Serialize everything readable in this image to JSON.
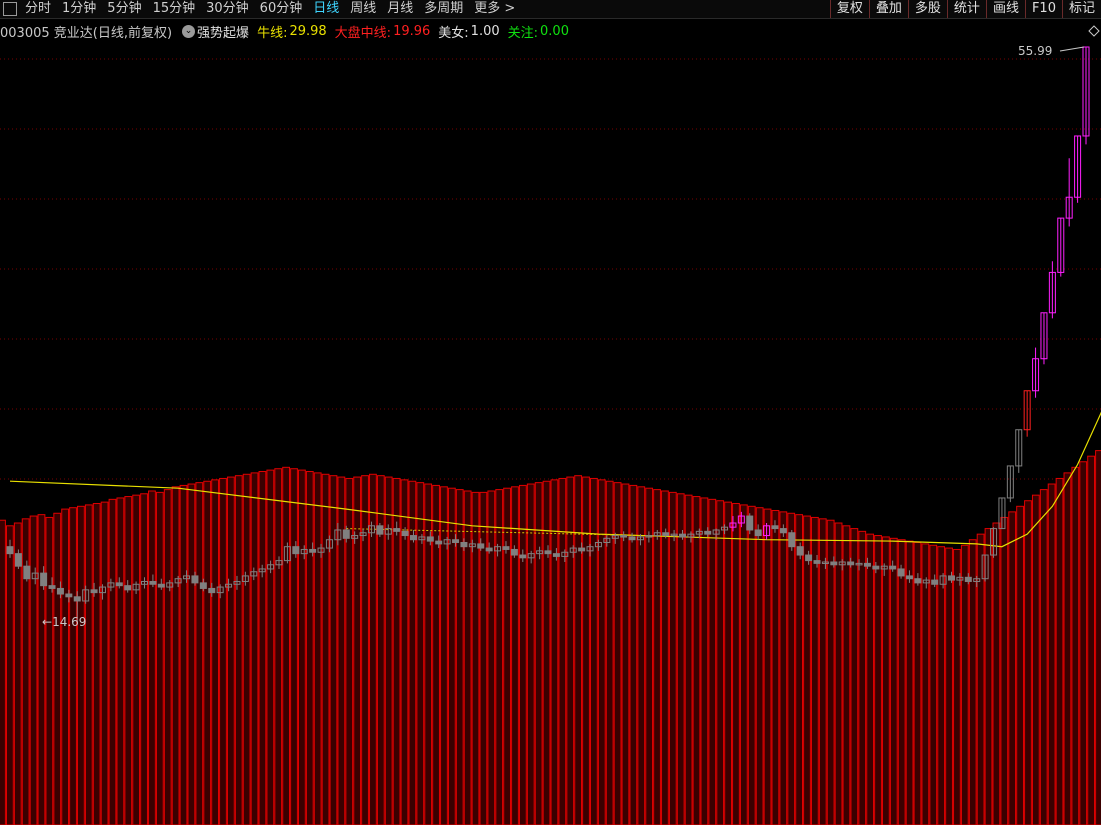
{
  "toolbar": {
    "periods": [
      "分时",
      "1分钟",
      "5分钟",
      "15分钟",
      "30分钟",
      "60分钟",
      "日线",
      "周线",
      "月线",
      "多周期",
      "更多 >"
    ],
    "active_period": "日线",
    "right_buttons": [
      "复权",
      "叠加",
      "多股",
      "统计",
      "画线",
      "F10",
      "标记"
    ]
  },
  "info": {
    "stock": "003005 竞业达(日线,前复权)",
    "indicator": "强势起爆",
    "bull_label": "牛线:",
    "bull_value": "29.98",
    "dapan_label": "大盘中线:",
    "dapan_value": "19.96",
    "meinv_label": "美女:",
    "meinv_value": "1.00",
    "guanzhu_label": "关注:",
    "guanzhu_value": "0.00"
  },
  "labels": {
    "high": "55.99",
    "low": "14.69"
  },
  "colors": {
    "bull_line": "#e8e000",
    "dapan": "#ff2020",
    "up": "#ff20ff",
    "down": "#808080",
    "bar": "#e00000",
    "grid": "#7a0000",
    "green": "#10e010"
  },
  "chart_data": {
    "type": "candlestick",
    "price_high": 55.99,
    "price_low": 14.69,
    "candles": [
      [
        20.1,
        20.6,
        19.3,
        19.6
      ],
      [
        19.6,
        19.9,
        18.5,
        18.7
      ],
      [
        18.7,
        19.1,
        17.6,
        17.8
      ],
      [
        17.8,
        18.6,
        17.4,
        18.2
      ],
      [
        18.2,
        18.7,
        17.0,
        17.3
      ],
      [
        17.3,
        17.9,
        16.8,
        17.1
      ],
      [
        17.1,
        17.6,
        16.4,
        16.7
      ],
      [
        16.7,
        17.0,
        16.1,
        16.5
      ],
      [
        16.5,
        16.9,
        14.7,
        16.2
      ],
      [
        16.2,
        17.3,
        16.0,
        17.0
      ],
      [
        17.0,
        17.5,
        16.5,
        16.8
      ],
      [
        16.8,
        17.4,
        16.3,
        17.2
      ],
      [
        17.2,
        17.8,
        16.9,
        17.5
      ],
      [
        17.5,
        17.9,
        17.1,
        17.3
      ],
      [
        17.3,
        17.7,
        16.8,
        17.0
      ],
      [
        17.0,
        17.6,
        16.7,
        17.4
      ],
      [
        17.4,
        17.9,
        17.1,
        17.6
      ],
      [
        17.6,
        18.1,
        17.2,
        17.4
      ],
      [
        17.4,
        17.8,
        17.0,
        17.2
      ],
      [
        17.2,
        17.7,
        16.9,
        17.5
      ],
      [
        17.5,
        18.0,
        17.2,
        17.8
      ],
      [
        17.8,
        18.4,
        17.5,
        18.0
      ],
      [
        18.0,
        18.3,
        17.3,
        17.5
      ],
      [
        17.5,
        17.8,
        16.9,
        17.1
      ],
      [
        17.1,
        17.5,
        16.5,
        16.8
      ],
      [
        16.8,
        17.4,
        16.4,
        17.2
      ],
      [
        17.2,
        17.8,
        16.9,
        17.4
      ],
      [
        17.4,
        18.0,
        17.0,
        17.6
      ],
      [
        17.6,
        18.3,
        17.3,
        18.0
      ],
      [
        18.0,
        18.6,
        17.7,
        18.3
      ],
      [
        18.3,
        18.8,
        17.9,
        18.5
      ],
      [
        18.5,
        19.1,
        18.2,
        18.8
      ],
      [
        18.8,
        19.4,
        18.5,
        19.1
      ],
      [
        19.1,
        20.4,
        18.9,
        20.1
      ],
      [
        20.1,
        20.5,
        19.3,
        19.6
      ],
      [
        19.6,
        20.2,
        19.2,
        19.9
      ],
      [
        19.9,
        20.4,
        19.4,
        19.7
      ],
      [
        19.7,
        20.3,
        19.3,
        20.0
      ],
      [
        20.0,
        20.9,
        19.7,
        20.6
      ],
      [
        20.6,
        21.8,
        20.2,
        21.3
      ],
      [
        21.3,
        21.6,
        20.4,
        20.7
      ],
      [
        20.7,
        21.2,
        20.3,
        20.9
      ],
      [
        20.9,
        21.4,
        20.5,
        21.1
      ],
      [
        21.1,
        21.9,
        20.8,
        21.6
      ],
      [
        21.6,
        21.8,
        20.8,
        21.0
      ],
      [
        21.0,
        21.7,
        20.6,
        21.4
      ],
      [
        21.4,
        21.9,
        20.9,
        21.2
      ],
      [
        21.2,
        21.5,
        20.6,
        20.9
      ],
      [
        20.9,
        21.3,
        20.4,
        20.6
      ],
      [
        20.6,
        21.0,
        20.3,
        20.8
      ],
      [
        20.8,
        21.2,
        20.2,
        20.5
      ],
      [
        20.5,
        20.9,
        20.0,
        20.3
      ],
      [
        20.3,
        20.8,
        19.9,
        20.6
      ],
      [
        20.6,
        21.0,
        20.1,
        20.4
      ],
      [
        20.4,
        20.7,
        19.8,
        20.1
      ],
      [
        20.1,
        20.6,
        19.7,
        20.3
      ],
      [
        20.3,
        20.7,
        19.8,
        20.0
      ],
      [
        20.0,
        20.4,
        19.6,
        19.8
      ],
      [
        19.8,
        20.3,
        19.4,
        20.1
      ],
      [
        20.1,
        20.5,
        19.6,
        19.9
      ],
      [
        19.9,
        20.2,
        19.3,
        19.5
      ],
      [
        19.5,
        19.9,
        19.0,
        19.3
      ],
      [
        19.3,
        19.8,
        18.9,
        19.6
      ],
      [
        19.6,
        20.1,
        19.2,
        19.8
      ],
      [
        19.8,
        20.2,
        19.3,
        19.6
      ],
      [
        19.6,
        20.0,
        19.1,
        19.4
      ],
      [
        19.4,
        19.9,
        19.0,
        19.7
      ],
      [
        19.7,
        20.2,
        19.3,
        20.0
      ],
      [
        20.0,
        20.4,
        19.6,
        19.8
      ],
      [
        19.8,
        20.3,
        19.4,
        20.1
      ],
      [
        20.1,
        20.6,
        19.8,
        20.4
      ],
      [
        20.4,
        20.9,
        20.1,
        20.7
      ],
      [
        20.7,
        21.1,
        20.3,
        20.9
      ],
      [
        20.9,
        21.2,
        20.5,
        20.8
      ],
      [
        20.8,
        21.1,
        20.4,
        20.6
      ],
      [
        20.6,
        21.0,
        20.2,
        20.8
      ],
      [
        20.8,
        21.2,
        20.4,
        20.9
      ],
      [
        20.9,
        21.3,
        20.6,
        21.1
      ],
      [
        21.1,
        21.4,
        20.7,
        20.9
      ],
      [
        20.9,
        21.3,
        20.5,
        21.0
      ],
      [
        21.0,
        21.3,
        20.6,
        20.8
      ],
      [
        20.8,
        21.2,
        20.4,
        21.0
      ],
      [
        21.0,
        21.4,
        20.7,
        21.2
      ],
      [
        21.2,
        21.5,
        20.8,
        21.0
      ],
      [
        21.0,
        21.4,
        20.6,
        21.3
      ],
      [
        21.3,
        21.7,
        21.0,
        21.5
      ],
      [
        21.5,
        22.3,
        21.2,
        21.8
      ],
      [
        21.8,
        22.6,
        21.5,
        22.3
      ],
      [
        22.3,
        22.5,
        21.0,
        21.3
      ],
      [
        21.3,
        21.7,
        20.6,
        20.9
      ],
      [
        20.9,
        21.8,
        20.6,
        21.6
      ],
      [
        21.6,
        22.0,
        21.1,
        21.4
      ],
      [
        21.4,
        21.7,
        20.8,
        21.1
      ],
      [
        21.1,
        21.3,
        19.8,
        20.1
      ],
      [
        20.1,
        20.4,
        19.2,
        19.5
      ],
      [
        19.5,
        19.8,
        18.8,
        19.1
      ],
      [
        19.1,
        19.5,
        18.6,
        18.9
      ],
      [
        18.9,
        19.3,
        18.5,
        19.0
      ],
      [
        19.0,
        19.4,
        18.6,
        18.8
      ],
      [
        18.8,
        19.2,
        18.4,
        19.0
      ],
      [
        19.0,
        19.3,
        18.6,
        18.8
      ],
      [
        18.8,
        19.2,
        18.4,
        18.9
      ],
      [
        18.9,
        19.3,
        18.5,
        18.7
      ],
      [
        18.7,
        19.0,
        18.2,
        18.5
      ],
      [
        18.5,
        18.9,
        18.0,
        18.7
      ],
      [
        18.7,
        19.1,
        18.3,
        18.5
      ],
      [
        18.5,
        18.8,
        17.8,
        18.0
      ],
      [
        18.0,
        18.4,
        17.5,
        17.8
      ],
      [
        17.8,
        18.2,
        17.3,
        17.5
      ],
      [
        17.5,
        17.9,
        17.1,
        17.7
      ],
      [
        17.7,
        18.1,
        17.2,
        17.4
      ],
      [
        17.4,
        18.2,
        17.1,
        18.0
      ],
      [
        18.0,
        18.3,
        17.5,
        17.7
      ],
      [
        17.7,
        18.2,
        17.3,
        17.9
      ],
      [
        17.9,
        18.2,
        17.4,
        17.6
      ],
      [
        17.6,
        18.0,
        17.2,
        17.8
      ],
      [
        17.8,
        19.5,
        17.6,
        19.5
      ],
      [
        19.5,
        21.5,
        19.3,
        21.4
      ],
      [
        21.4,
        23.6,
        21.4,
        23.6
      ],
      [
        23.6,
        25.9,
        23.3,
        25.9
      ],
      [
        25.9,
        28.5,
        25.4,
        28.5
      ],
      [
        28.5,
        31.3,
        28.0,
        31.3
      ],
      [
        31.3,
        34.4,
        30.8,
        33.6
      ],
      [
        33.6,
        36.9,
        33.2,
        36.9
      ],
      [
        36.9,
        40.6,
        36.5,
        39.8
      ],
      [
        39.8,
        43.7,
        39.5,
        43.7
      ],
      [
        43.7,
        48.0,
        43.1,
        45.2
      ],
      [
        45.2,
        49.6,
        44.8,
        49.6
      ],
      [
        49.6,
        55.99,
        49.0,
        55.99
      ]
    ],
    "bull_line": [
      {
        "bar": 0,
        "price": 24.8
      },
      {
        "bar": 20,
        "price": 24.3
      },
      {
        "bar": 40,
        "price": 22.8
      },
      {
        "bar": 55,
        "price": 21.6
      },
      {
        "bar": 70,
        "price": 21.0
      },
      {
        "bar": 90,
        "price": 20.6
      },
      {
        "bar": 105,
        "price": 20.5
      },
      {
        "bar": 115,
        "price": 20.3
      },
      {
        "bar": 118,
        "price": 20.1
      },
      {
        "bar": 121,
        "price": 21.0
      },
      {
        "bar": 124,
        "price": 23.0
      },
      {
        "bar": 127,
        "price": 26.0
      },
      {
        "bar": 130,
        "price": 29.98
      }
    ],
    "volume_top": [
      22.0,
      21.6,
      21.8,
      22.1,
      22.3,
      22.4,
      22.2,
      22.5,
      22.8,
      22.9,
      23.0,
      23.1,
      23.2,
      23.3,
      23.5,
      23.6,
      23.7,
      23.8,
      23.9,
      24.1,
      24.0,
      24.2,
      24.4,
      24.5,
      24.6,
      24.7,
      24.8,
      24.9,
      25.0,
      25.1,
      25.2,
      25.3,
      25.4,
      25.5,
      25.6,
      25.7,
      25.8,
      25.7,
      25.6,
      25.5,
      25.4,
      25.3,
      25.2,
      25.1,
      25.0,
      25.1,
      25.2,
      25.3,
      25.2,
      25.1,
      25.0,
      24.9,
      24.8,
      24.7,
      24.6,
      24.5,
      24.4,
      24.3,
      24.2,
      24.1,
      24.0,
      24.0,
      24.1,
      24.2,
      24.3,
      24.4,
      24.5,
      24.6,
      24.7,
      24.8,
      24.9,
      25.0,
      25.1,
      25.2,
      25.1,
      25.0,
      24.9,
      24.8,
      24.7,
      24.6,
      24.5,
      24.4,
      24.3,
      24.2,
      24.1,
      24.0,
      23.9,
      23.8,
      23.7,
      23.6,
      23.5,
      23.4,
      23.3,
      23.2,
      23.1,
      23.0,
      22.9,
      22.8,
      22.7,
      22.6,
      22.5,
      22.4,
      22.3,
      22.2,
      22.1,
      22.0,
      21.8,
      21.6,
      21.4,
      21.2,
      21.0,
      20.9,
      20.8,
      20.7,
      20.6,
      20.5,
      20.4,
      20.3,
      20.2,
      20.1,
      20.0,
      19.9,
      20.2,
      20.6,
      21.0,
      21.4,
      21.8,
      22.2,
      22.6,
      23.0,
      23.4,
      23.8,
      24.2,
      24.6,
      25.0,
      25.4,
      25.8,
      26.2,
      26.6,
      27.0
    ]
  }
}
